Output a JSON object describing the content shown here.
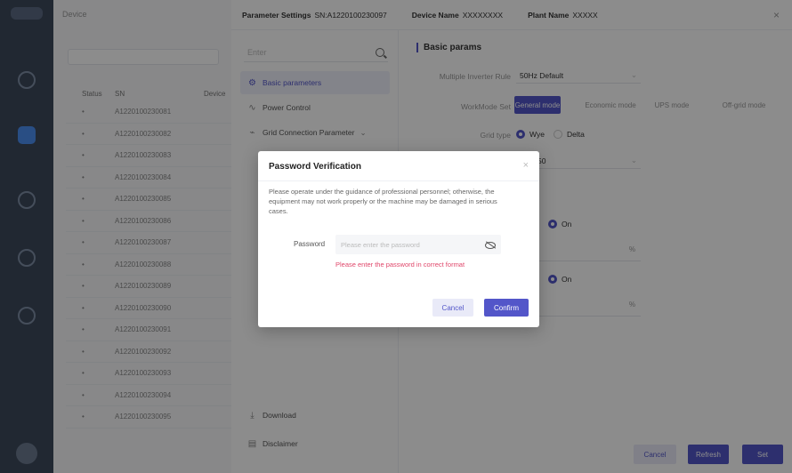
{
  "background": {
    "breadcrumb": "Device",
    "table_headers": [
      "Status",
      "SN",
      "Device"
    ],
    "rows": [
      "A1220100230081",
      "A1220100230082",
      "A1220100230083",
      "A1220100230084",
      "A1220100230085",
      "A1220100230086",
      "A1220100230087",
      "A1220100230088",
      "A1220100230089",
      "A1220100230090",
      "A1220100230091",
      "A1220100230092",
      "A1220100230093",
      "A1220100230094",
      "A1220100230095"
    ]
  },
  "drawer": {
    "header": {
      "param_label": "Parameter Settings",
      "sn": "SN:A1220100230097",
      "device_label": "Device Name",
      "device_value": "XXXXXXXX",
      "plant_label": "Plant Name",
      "plant_value": "XXXXX",
      "close": "×"
    },
    "menu": {
      "search_placeholder": "Enter",
      "items": [
        {
          "label": "Basic parameters",
          "icon": "⚙"
        },
        {
          "label": "Power Control",
          "icon": "∿"
        },
        {
          "label": "Grid Connection Parameter",
          "icon": "⌁"
        }
      ],
      "chevron": "⌄",
      "bottom_items": [
        {
          "label": "Download",
          "icon": "⤓"
        },
        {
          "label": "Disclaimer",
          "icon": "▤"
        }
      ]
    },
    "content": {
      "section_title": "Basic params",
      "multiple_rule_label": "Multiple Inverter Rule",
      "multiple_rule_value": "50Hz Default",
      "workmode_label": "WorkMode Set",
      "workmodes": [
        "General mode",
        "Economic mode",
        "UPS mode",
        "Off-grid mode"
      ],
      "grid_type_label": "Grid type",
      "grid_types": [
        "Wye",
        "Delta"
      ],
      "freq_value": "50",
      "on_label": "On",
      "pct": "%",
      "buttons": {
        "cancel": "Cancel",
        "refresh": "Refresh",
        "set": "Set"
      }
    }
  },
  "modal": {
    "title": "Password Verification",
    "close": "×",
    "message": "Please operate under the guidance of professional personnel; otherwise, the equipment may not work properly or the machine may be damaged in serious cases.",
    "password_label": "Password",
    "password_placeholder": "Please enter the password",
    "error": "Please enter the password in correct format",
    "cancel": "Cancel",
    "confirm": "Confirm"
  }
}
